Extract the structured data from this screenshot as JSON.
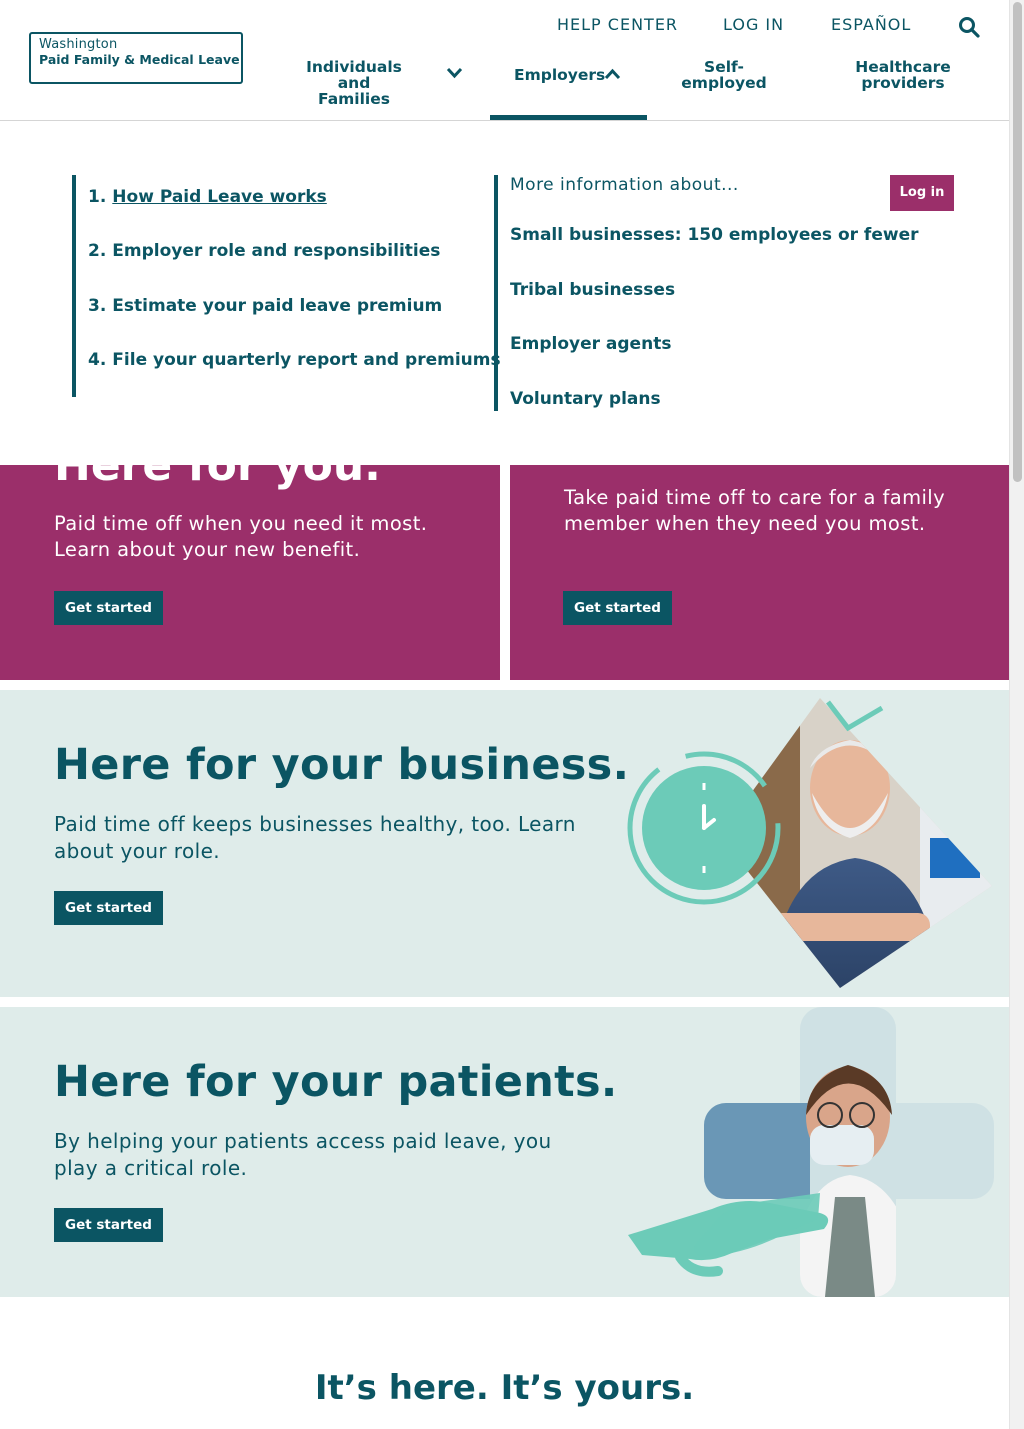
{
  "header": {
    "logo_line1": "Washington",
    "logo_line2": "Paid Family & Medical Leave",
    "utility": {
      "help": "HELP CENTER",
      "login": "LOG IN",
      "spanish": "ESPAÑOL"
    },
    "nav": {
      "individuals_1": "Individuals and",
      "individuals_2": "Families",
      "employers": "Employers",
      "self_1": "Self-",
      "self_2": "employed",
      "health_1": "Healthcare",
      "health_2": "providers"
    }
  },
  "dropdown": {
    "steps": [
      {
        "num": "1.",
        "label": "How Paid Leave works"
      },
      {
        "num": "2.",
        "label": "Employer role and responsibilities"
      },
      {
        "num": "3.",
        "label": "Estimate your paid leave premium"
      },
      {
        "num": "4.",
        "label": "File your quarterly report and premiums"
      }
    ],
    "more_heading": "More information about...",
    "more_links": [
      "Small businesses: 150 employees or fewer",
      "Tribal businesses",
      "Employer agents",
      "Voluntary plans"
    ],
    "login_button": "Log in"
  },
  "cards": [
    {
      "title": "Here for you.",
      "text": "Paid time off when you need it most. Learn about your new benefit.",
      "button": "Get started"
    },
    {
      "text": "Take paid time off to care for a family member when they need you most.",
      "button": "Get started"
    }
  ],
  "business": {
    "title": "Here for your business.",
    "text": "Paid time off keeps businesses healthy, too. Learn about your role.",
    "button": "Get started"
  },
  "patients": {
    "title": "Here for your patients.",
    "text": "By helping your patients access paid leave, you play a critical role.",
    "button": "Get started"
  },
  "footer_heading": "It’s here. It’s yours.",
  "colors": {
    "teal": "#0b5563",
    "magenta": "#9b2f6a",
    "mint_bg": "#dfecea",
    "accent_mint": "#6ccbb8"
  }
}
